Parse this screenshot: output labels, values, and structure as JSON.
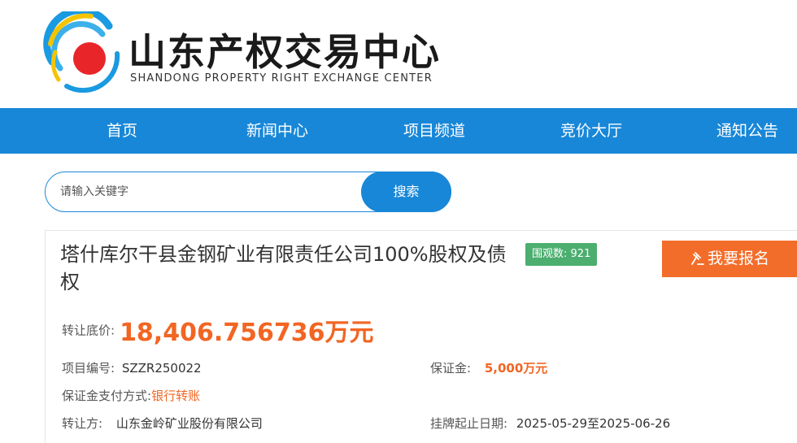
{
  "brand": {
    "name_cn": "山东产权交易中心",
    "name_en": "SHANDONG PROPERTY RIGHT EXCHANGE CENTER",
    "icon": "swirl-logo-icon",
    "colors": {
      "blue": "#1a9ae0",
      "yellow": "#f5c400",
      "red": "#e8262a"
    }
  },
  "nav": {
    "items": [
      {
        "label": "首页"
      },
      {
        "label": "新闻中心"
      },
      {
        "label": "项目频道"
      },
      {
        "label": "竞价大厅"
      },
      {
        "label": "通知公告"
      }
    ],
    "color": "#1887d8"
  },
  "search": {
    "placeholder": "请输入关键字",
    "value": "",
    "button_label": "搜索"
  },
  "project": {
    "title": "塔什库尔干县金钢矿业有限责任公司100%股权及债权",
    "views_label": "围观数:",
    "views_count": "921",
    "signup_label": "我要报名",
    "signup_icon": "gavel-icon",
    "price_label": "转让底价:",
    "price_value": "18,406.756736万元",
    "code_label": "项目编号:",
    "code_value": "SZZR250022",
    "deposit_label": "保证金:",
    "deposit_value": "5,000万元",
    "payment_label": "保证金支付方式:",
    "payment_value": "银行转账",
    "transferor_label": "转让方:",
    "transferor_value": "山东金岭矿业股份有限公司",
    "listing_label": "挂牌起止日期:",
    "listing_value": "2025-05-29至2025-06-26",
    "accent_color": "#f26522"
  }
}
